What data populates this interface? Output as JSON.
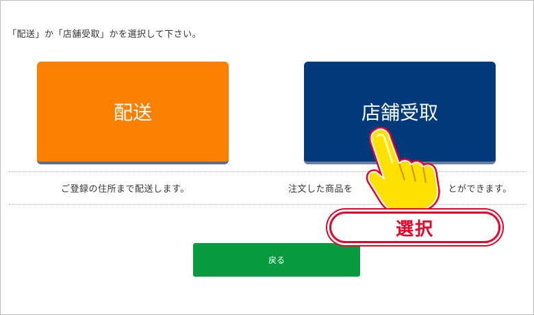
{
  "instruction": "「配送」か「店舗受取」かを選択して下さい。",
  "options": [
    {
      "label": "配送",
      "description": "ご登録の住所まで配送します。",
      "color": "#f98000"
    },
    {
      "label": "店舗受取",
      "description": "注文した商品を                              とができます。",
      "color": "#003a7a"
    }
  ],
  "back_button": {
    "label": "戻る",
    "color": "#079b3f"
  },
  "callout": {
    "label": "選択",
    "color": "#e6002a"
  },
  "pointer_icon": "pointing-hand-icon"
}
